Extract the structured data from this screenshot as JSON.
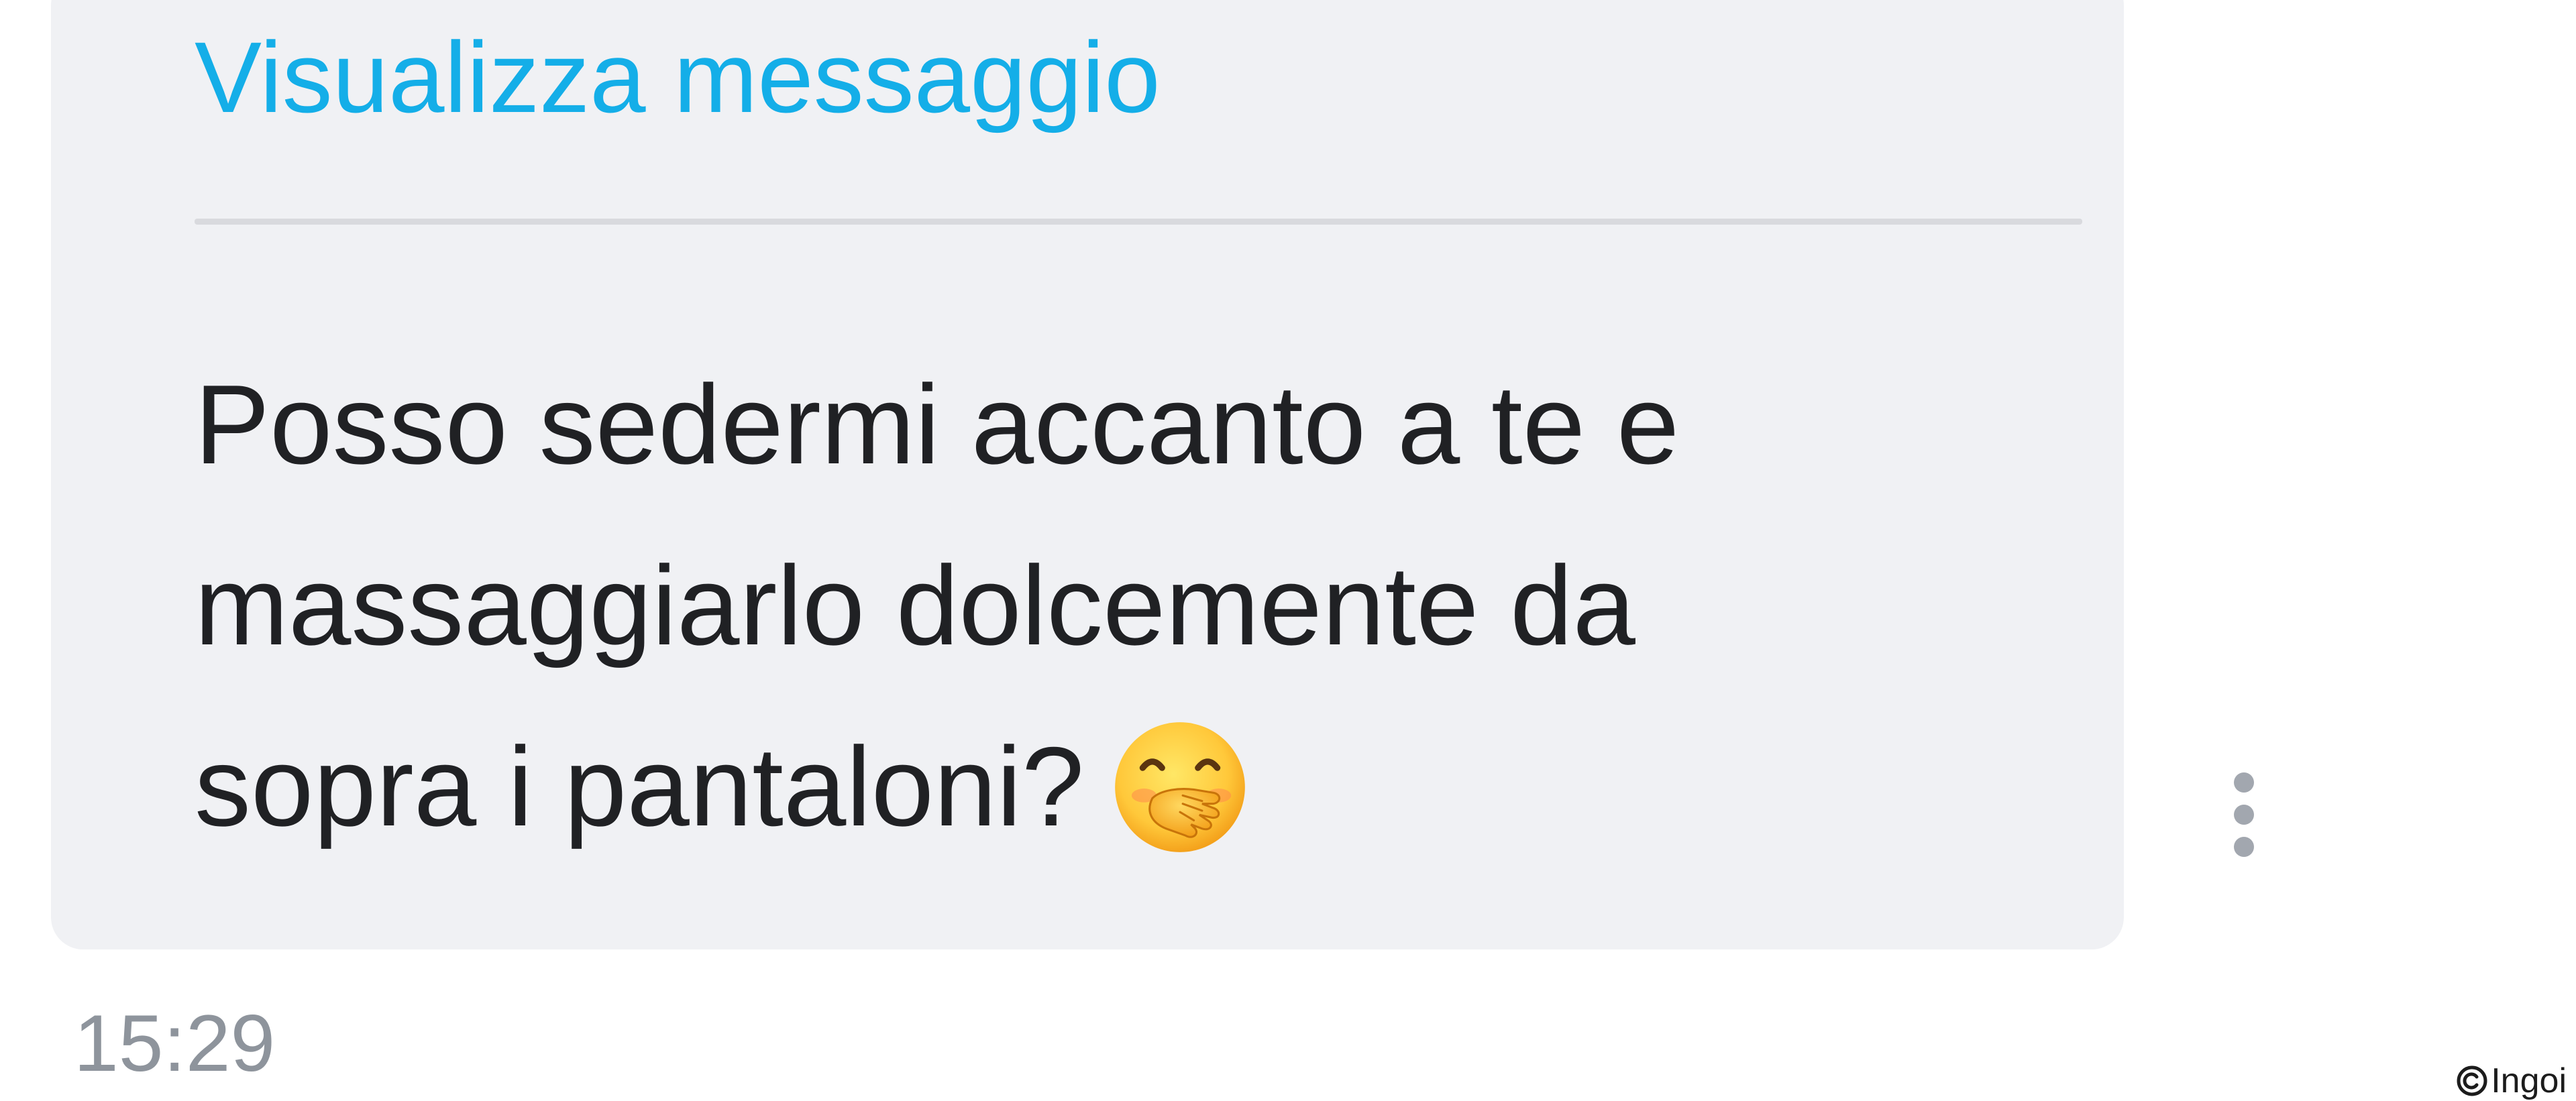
{
  "message": {
    "view_link_label": "Visualizza messaggio",
    "lines": [
      "Posso sedermi accanto a te e",
      "massaggiarlo dolcemente da",
      "sopra i pantaloni?"
    ],
    "emoji": "face-with-hand-over-mouth",
    "timestamp": "15:29"
  },
  "watermark": {
    "text": "Ingoi",
    "icon": "copyright-icon"
  },
  "colors": {
    "bubble_background": "#f0f1f4",
    "link": "#14aee8",
    "text": "#202124",
    "timestamp": "#8e949c",
    "menu_dots": "#a2a7af"
  }
}
